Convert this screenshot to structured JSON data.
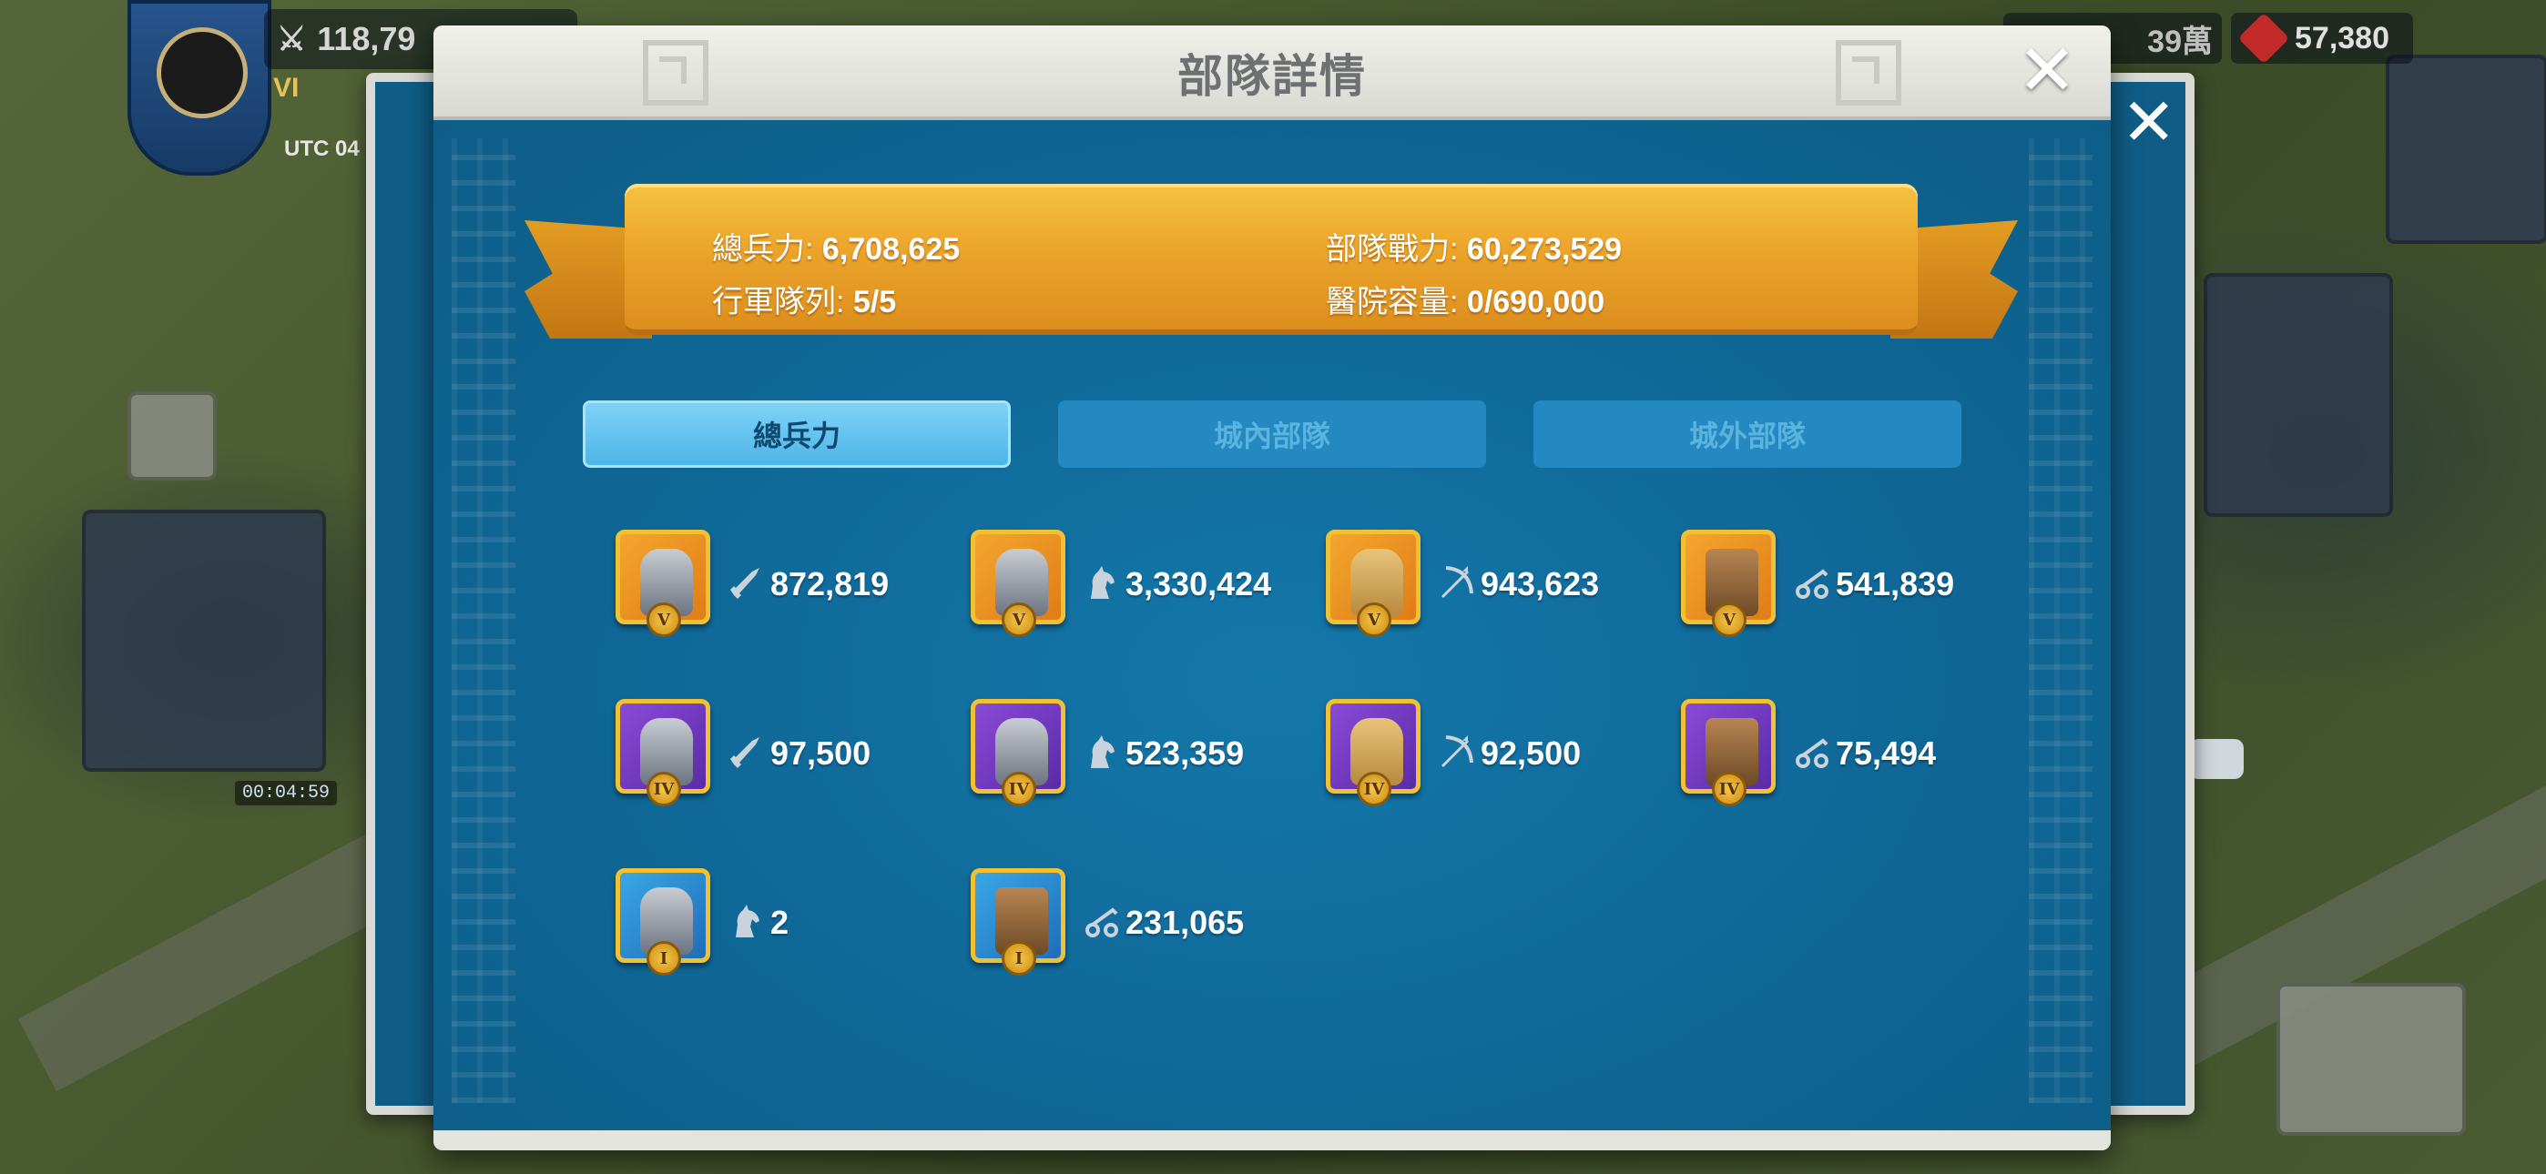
{
  "hud": {
    "power": "118,79",
    "vip": "VI",
    "utc": "UTC 04",
    "resource_partial": "39萬",
    "gems": "57,380",
    "timer": "00:04:59"
  },
  "dialog": {
    "title": "部隊詳情",
    "close_glyph": "✕"
  },
  "summary": {
    "total_troops_label": "總兵力: ",
    "total_troops_value": "6,708,625",
    "troop_power_label": "部隊戰力: ",
    "troop_power_value": "60,273,529",
    "march_queue_label": "行軍隊列: ",
    "march_queue_value": "5/5",
    "hospital_label": "醫院容量: ",
    "hospital_value": "0/690,000"
  },
  "tabs": [
    {
      "label": "總兵力",
      "active": true
    },
    {
      "label": "城內部隊",
      "active": false
    },
    {
      "label": "城外部隊",
      "active": false
    }
  ],
  "troops": [
    {
      "tier": "V",
      "type": "infantry",
      "icon": "infantry-sword-icon",
      "count": "872,819",
      "frame": "gold"
    },
    {
      "tier": "V",
      "type": "cavalry",
      "icon": "cavalry-horse-icon",
      "count": "3,330,424",
      "frame": "gold"
    },
    {
      "tier": "V",
      "type": "archer",
      "icon": "archer-bow-icon",
      "count": "943,623",
      "frame": "gold"
    },
    {
      "tier": "V",
      "type": "siege",
      "icon": "siege-catapult-icon",
      "count": "541,839",
      "frame": "gold"
    },
    {
      "tier": "IV",
      "type": "infantry",
      "icon": "infantry-sword-icon",
      "count": "97,500",
      "frame": "purple"
    },
    {
      "tier": "IV",
      "type": "cavalry",
      "icon": "cavalry-horse-icon",
      "count": "523,359",
      "frame": "purple"
    },
    {
      "tier": "IV",
      "type": "archer",
      "icon": "archer-bow-icon",
      "count": "92,500",
      "frame": "purple"
    },
    {
      "tier": "IV",
      "type": "siege",
      "icon": "siege-catapult-icon",
      "count": "75,494",
      "frame": "purple"
    },
    {
      "tier": "I",
      "type": "cavalry",
      "icon": "cavalry-horse-icon",
      "count": "2",
      "frame": "blue"
    },
    {
      "tier": "I",
      "type": "siege",
      "icon": "siege-catapult-icon",
      "count": "231,065",
      "frame": "blue"
    }
  ],
  "colors": {
    "panel_blue": "#0f6796",
    "ribbon_gold": "#eba52a",
    "tab_active": "#4eb5e8",
    "tab_inactive": "#2389c0"
  }
}
